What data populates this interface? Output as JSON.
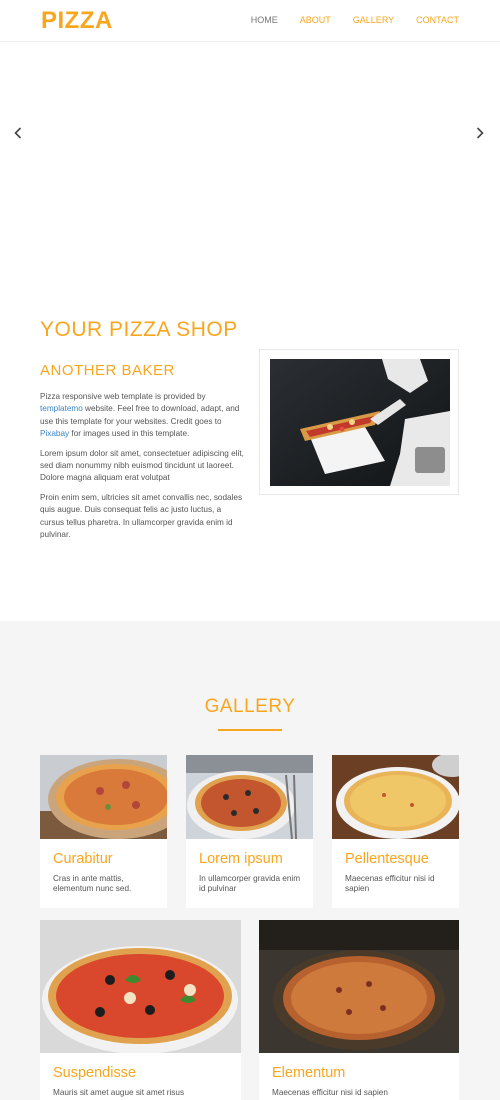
{
  "header": {
    "logo": "PIZZA",
    "nav": [
      {
        "label": "HOME",
        "active": true
      },
      {
        "label": "ABOUT",
        "active": false
      },
      {
        "label": "GALLERY",
        "active": false
      },
      {
        "label": "CONTACT",
        "active": false
      }
    ]
  },
  "hero": {
    "prev_icon": "chevron-left-icon",
    "next_icon": "chevron-right-icon"
  },
  "about": {
    "title": "YOUR PIZZA SHOP",
    "subtitle": "ANOTHER BAKER",
    "p1_a": "Pizza responsive web template is provided by ",
    "p1_link1": "templatemo",
    "p1_b": " website. Feel free to download, adapt, and use this template for your websites. Credit goes to ",
    "p1_link2": "Pixabay",
    "p1_c": " for images used in this template.",
    "p2": "Lorem ipsum dolor sit amet, consectetuer adipiscing elit, sed diam nonummy nibh euismod tincidunt ut laoreet. Dolore magna aliquam erat volutpat",
    "p3": "Proin enim sem, ultricies sit amet convallis nec, sodales quis augue. Duis consequat felis ac justo luctus, a cursus tellus pharetra. In ullamcorper gravida enim id pulvinar."
  },
  "gallery": {
    "title": "GALLERY",
    "cards": [
      {
        "title": "Curabitur",
        "desc": "Cras in ante mattis, elementum nunc sed."
      },
      {
        "title": "Lorem ipsum",
        "desc": "In ullamcorper gravida enim id pulvinar"
      },
      {
        "title": "Pellentesque",
        "desc": "Maecenas efficitur nisi id sapien"
      },
      {
        "title": "Suspendisse",
        "desc": "Mauris sit amet augue sit amet risus"
      },
      {
        "title": "Elementum",
        "desc": "Maecenas efficitur nisi id sapien"
      }
    ]
  },
  "colors": {
    "accent": "#f9a61f",
    "link": "#3a85c8",
    "gallery_bg": "#f5f5f5"
  }
}
